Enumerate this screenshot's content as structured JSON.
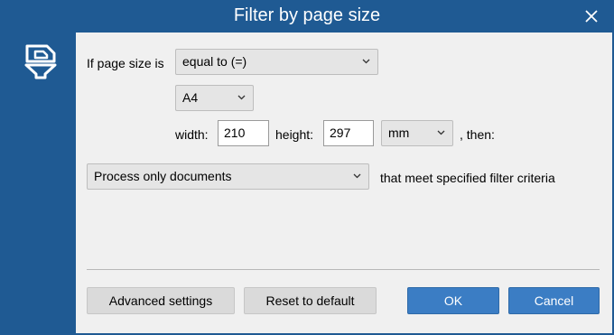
{
  "window": {
    "title": "Filter by page size",
    "close_icon": "close-icon"
  },
  "sidebar": {
    "icon": "filter-page-icon"
  },
  "form": {
    "if_label": "If page size is",
    "operator_value": "equal to (=)",
    "format_value": "A4",
    "width_label": "width:",
    "width_value": "210",
    "height_label": "height:",
    "height_value": "297",
    "unit_value": "mm",
    "then_label": ", then:",
    "action_value": "Process only documents",
    "criteria_label": "that meet specified filter criteria"
  },
  "buttons": {
    "advanced": "Advanced settings",
    "reset": "Reset to default",
    "ok": "OK",
    "cancel": "Cancel"
  },
  "colors": {
    "titlebar": "#1f5a93",
    "panel": "#f0f0f0",
    "primary_button": "#3b7dc4"
  }
}
